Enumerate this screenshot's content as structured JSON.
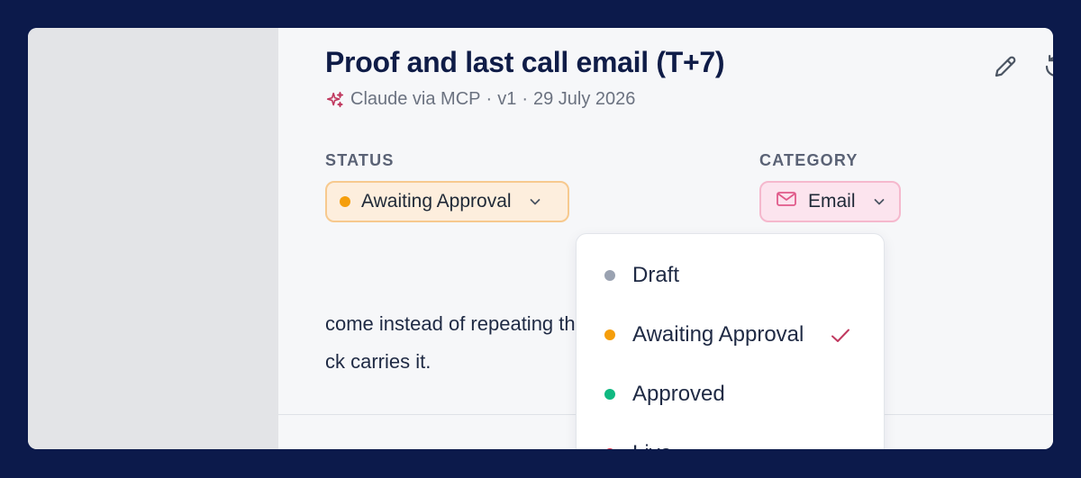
{
  "header": {
    "title": "Proof and last call email (T+7)",
    "author": "Claude via MCP",
    "version": "v1",
    "date": "29 July 2026",
    "separator": "·"
  },
  "icons": {
    "author": "sparkles-icon",
    "edit": "pencil-icon",
    "history": "history-icon",
    "category": "envelope-icon",
    "chevron": "chevron-down-icon",
    "selected": "checkmark-icon"
  },
  "status": {
    "label": "STATUS",
    "current": "Awaiting Approval",
    "current_color": "#f59e0b"
  },
  "category": {
    "label": "CATEGORY",
    "current": "Email",
    "color": "#e05a8a"
  },
  "body": {
    "line1": "come instead of repeating the announcer",
    "line2": "ck carries it."
  },
  "dropdown": {
    "options": [
      {
        "label": "Draft",
        "color": "#9aa2b1",
        "selected": false
      },
      {
        "label": "Awaiting Approval",
        "color": "#f59e0b",
        "selected": true
      },
      {
        "label": "Approved",
        "color": "#10b981",
        "selected": false
      },
      {
        "label": "Live",
        "color": "#dc2e4a",
        "selected": false
      }
    ]
  }
}
